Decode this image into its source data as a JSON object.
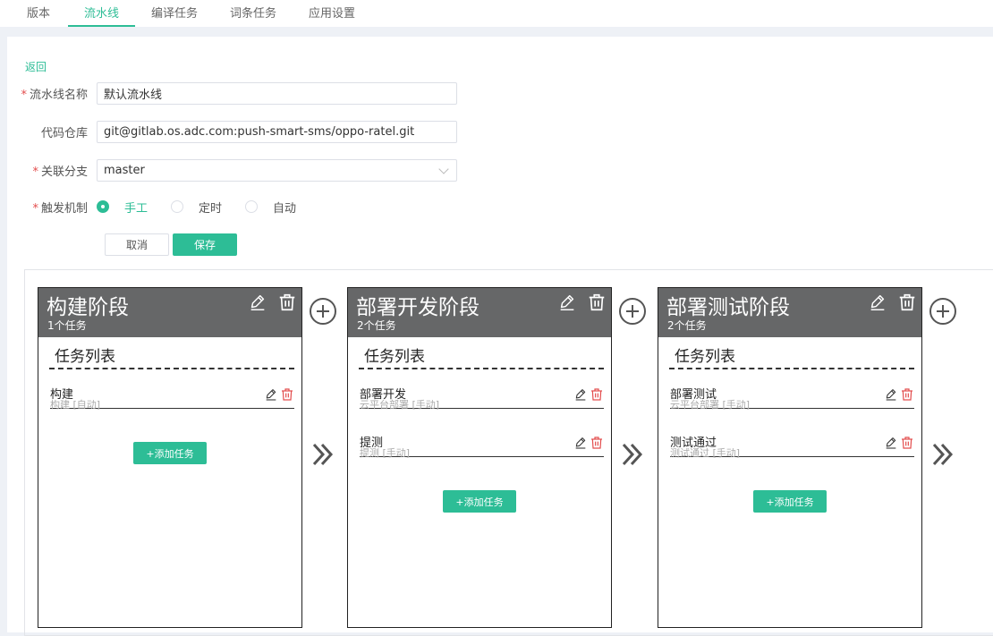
{
  "tabs": [
    {
      "label": "版本"
    },
    {
      "label": "流水线"
    },
    {
      "label": "编译任务"
    },
    {
      "label": "词条任务"
    },
    {
      "label": "应用设置"
    }
  ],
  "back_label": "返回",
  "form": {
    "name": {
      "label": "流水线名称",
      "value": "默认流水线"
    },
    "repo": {
      "label": "代码仓库",
      "value": "git@gitlab.os.adc.com:push-smart-sms/oppo-ratel.git"
    },
    "branch": {
      "label": "关联分支",
      "value": "master"
    },
    "trigger": {
      "label": "触发机制",
      "options": [
        "手工",
        "定时",
        "自动"
      ],
      "selected": "手工"
    },
    "cancel_label": "取消",
    "save_label": "保存"
  },
  "list_title": "任务列表",
  "add_task_label": "+添加任务",
  "stages": [
    {
      "title": "构建阶段",
      "count": "1个任务",
      "tasks": [
        {
          "name": "构建",
          "sub": "构建 [自动]"
        }
      ]
    },
    {
      "title": "部署开发阶段",
      "count": "2个任务",
      "tasks": [
        {
          "name": "部署开发",
          "sub": "云平台部署 [手动]"
        },
        {
          "name": "提测",
          "sub": "提测 [手动]"
        }
      ]
    },
    {
      "title": "部署测试阶段",
      "count": "2个任务",
      "tasks": [
        {
          "name": "部署测试",
          "sub": "云平台部署 [手动]"
        },
        {
          "name": "测试通过",
          "sub": "测试通过 [手动]"
        }
      ]
    }
  ],
  "colors": {
    "accent": "#2dbd96",
    "stage_header": "#666768",
    "delete": "#e34d4d"
  }
}
